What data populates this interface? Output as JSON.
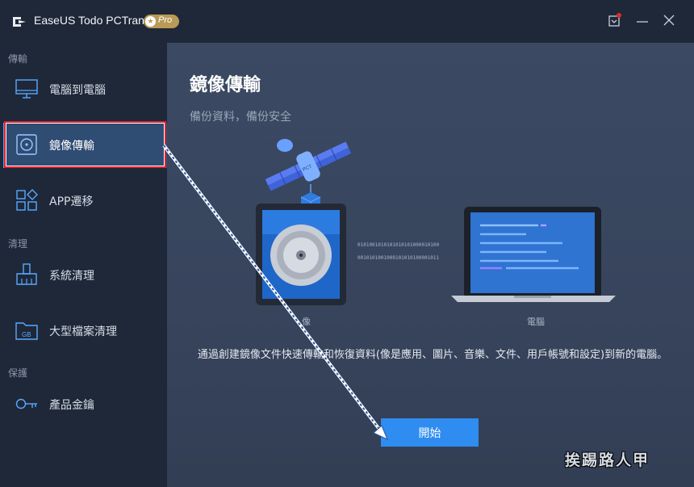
{
  "window": {
    "title": "EaseUS Todo PCTrans",
    "edition_badge": "Pro",
    "buttons": [
      "notification-icon",
      "minimize-icon",
      "close-icon"
    ]
  },
  "sidebar": {
    "sections": [
      {
        "label": "傳輸"
      },
      {
        "label": "清理"
      },
      {
        "label": "保護"
      }
    ],
    "items": [
      {
        "label": "電腦到電腦",
        "icon": "monitor-icon",
        "active": false
      },
      {
        "label": "鏡像傳輸",
        "icon": "disc-image-icon",
        "active": true
      },
      {
        "label": "APP遷移",
        "icon": "apps-grid-icon",
        "active": false
      },
      {
        "label": "系統清理",
        "icon": "broom-icon",
        "active": false
      },
      {
        "label": "大型檔案清理",
        "icon": "gb-folder-icon",
        "active": false
      },
      {
        "label": "產品金鑰",
        "icon": "key-icon",
        "active": false
      }
    ]
  },
  "main": {
    "title": "鏡像傳輸",
    "subtitle": "備份資料，備份安全",
    "illustration": {
      "image_caption": "像",
      "pc_caption": "電腦",
      "satellite_label": "PCT",
      "binary_line1": "0101001010101010101000010100",
      "binary_line2": "0010101001000101010100001011"
    },
    "description": "通過創建鏡像文件快速傳輸和恢復資料(像是應用、圖片、音樂、文件、用戶帳號和設定)到新的電腦。",
    "start_button": "開始"
  },
  "watermark": "挨踢路人甲",
  "colors": {
    "accent": "#2f8cf0",
    "sidebar_bg": "#1e2838",
    "active_item_bg": "#2f4c73",
    "highlight_border": "#e0222e",
    "pro_badge": "#b99a56"
  }
}
